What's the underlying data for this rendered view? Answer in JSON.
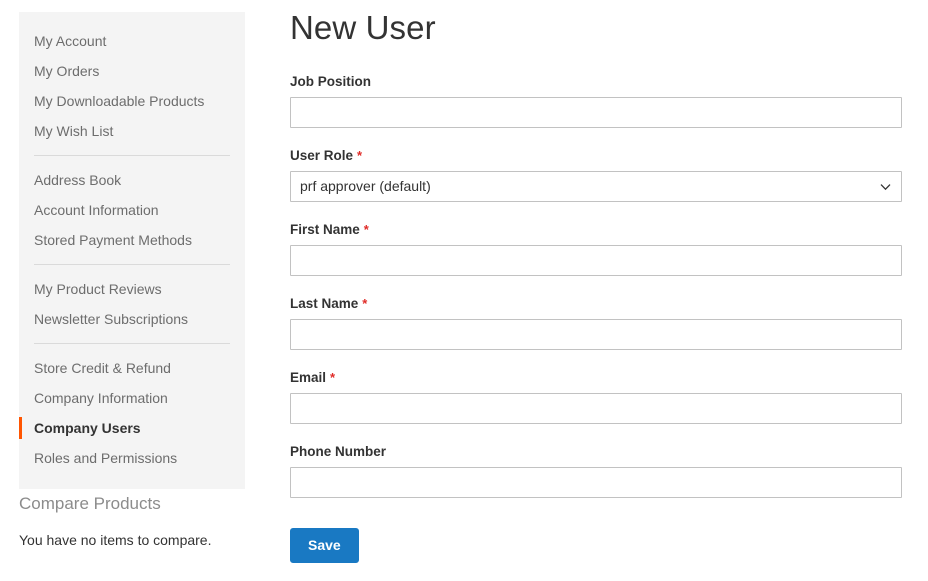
{
  "sidebar": {
    "groups": [
      {
        "items": [
          {
            "label": "My Account",
            "current": false
          },
          {
            "label": "My Orders",
            "current": false
          },
          {
            "label": "My Downloadable Products",
            "current": false
          },
          {
            "label": "My Wish List",
            "current": false
          }
        ]
      },
      {
        "items": [
          {
            "label": "Address Book",
            "current": false
          },
          {
            "label": "Account Information",
            "current": false
          },
          {
            "label": "Stored Payment Methods",
            "current": false
          }
        ]
      },
      {
        "items": [
          {
            "label": "My Product Reviews",
            "current": false
          },
          {
            "label": "Newsletter Subscriptions",
            "current": false
          }
        ]
      },
      {
        "items": [
          {
            "label": "Store Credit & Refund",
            "current": false
          },
          {
            "label": "Company Information",
            "current": false
          },
          {
            "label": "Company Users",
            "current": true
          },
          {
            "label": "Roles and Permissions",
            "current": false
          }
        ]
      }
    ],
    "current_marker_color": "#ff5501",
    "background_color": "#f4f4f4"
  },
  "compare": {
    "title": "Compare Products",
    "empty_text": "You have no items to compare."
  },
  "main": {
    "page_title": "New User",
    "required_mark": "*",
    "fields": [
      {
        "label": "Job Position",
        "required": false,
        "type": "text",
        "value": "",
        "placeholder": ""
      },
      {
        "label": "User Role",
        "required": true,
        "type": "select",
        "value": "prf approver (default)",
        "icon": "chevron-down-icon"
      },
      {
        "label": "First Name",
        "required": true,
        "type": "text",
        "value": "",
        "placeholder": ""
      },
      {
        "label": "Last Name",
        "required": true,
        "type": "text",
        "value": "",
        "placeholder": ""
      },
      {
        "label": "Email",
        "required": true,
        "type": "text",
        "value": "",
        "placeholder": ""
      },
      {
        "label": "Phone Number",
        "required": false,
        "type": "text",
        "value": "",
        "placeholder": ""
      }
    ],
    "save_label": "Save",
    "save_color": "#1979c3",
    "required_color": "#e02b27"
  }
}
